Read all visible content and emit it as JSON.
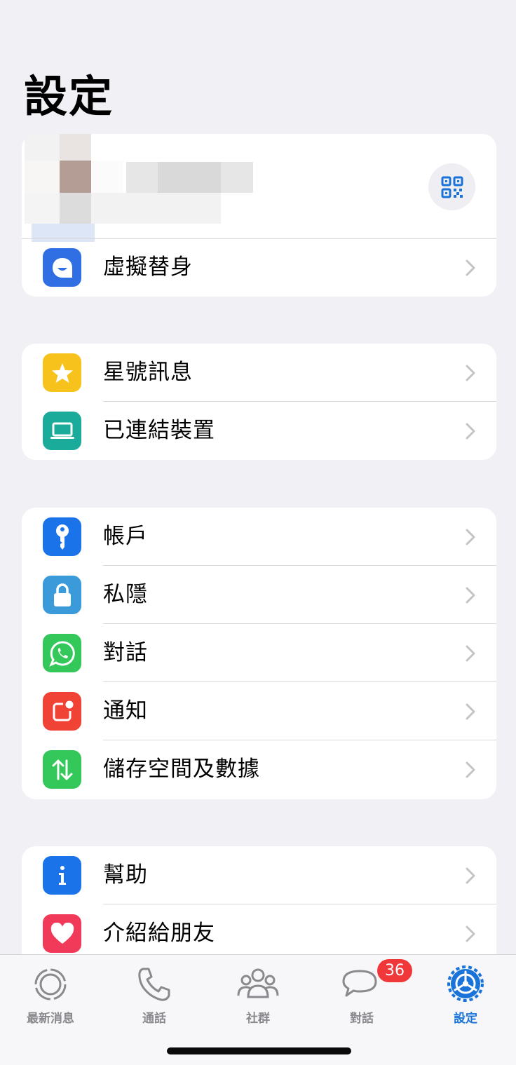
{
  "title": "設定",
  "profile": {
    "qr_icon": "qr-code-icon"
  },
  "avatar_section": {
    "label": "虛擬替身",
    "icon": "avatar-icon",
    "color": "#2f6fe3"
  },
  "group1": [
    {
      "label": "星號訊息",
      "icon": "star-icon",
      "color": "#f8c21c"
    },
    {
      "label": "已連結裝置",
      "icon": "laptop-icon",
      "color": "#1aab9b"
    }
  ],
  "group2": [
    {
      "label": "帳戶",
      "icon": "key-icon",
      "color": "#1a73e8"
    },
    {
      "label": "私隱",
      "icon": "lock-icon",
      "color": "#3b9ad9"
    },
    {
      "label": "對話",
      "icon": "whatsapp-icon",
      "color": "#34c759"
    },
    {
      "label": "通知",
      "icon": "notification-icon",
      "color": "#f14236"
    },
    {
      "label": "儲存空間及數據",
      "icon": "data-transfer-icon",
      "color": "#34c759"
    }
  ],
  "group3": [
    {
      "label": "幫助",
      "icon": "info-icon",
      "color": "#1a73e8"
    },
    {
      "label": "介紹給朋友",
      "icon": "heart-icon",
      "color": "#f13a5a"
    }
  ],
  "tabbar": {
    "tabs": [
      {
        "label": "最新消息",
        "icon": "updates-icon"
      },
      {
        "label": "通話",
        "icon": "phone-icon"
      },
      {
        "label": "社群",
        "icon": "community-icon"
      },
      {
        "label": "對話",
        "icon": "chats-icon"
      },
      {
        "label": "設定",
        "icon": "settings-icon",
        "active": true
      }
    ],
    "chats_badge": "36"
  }
}
